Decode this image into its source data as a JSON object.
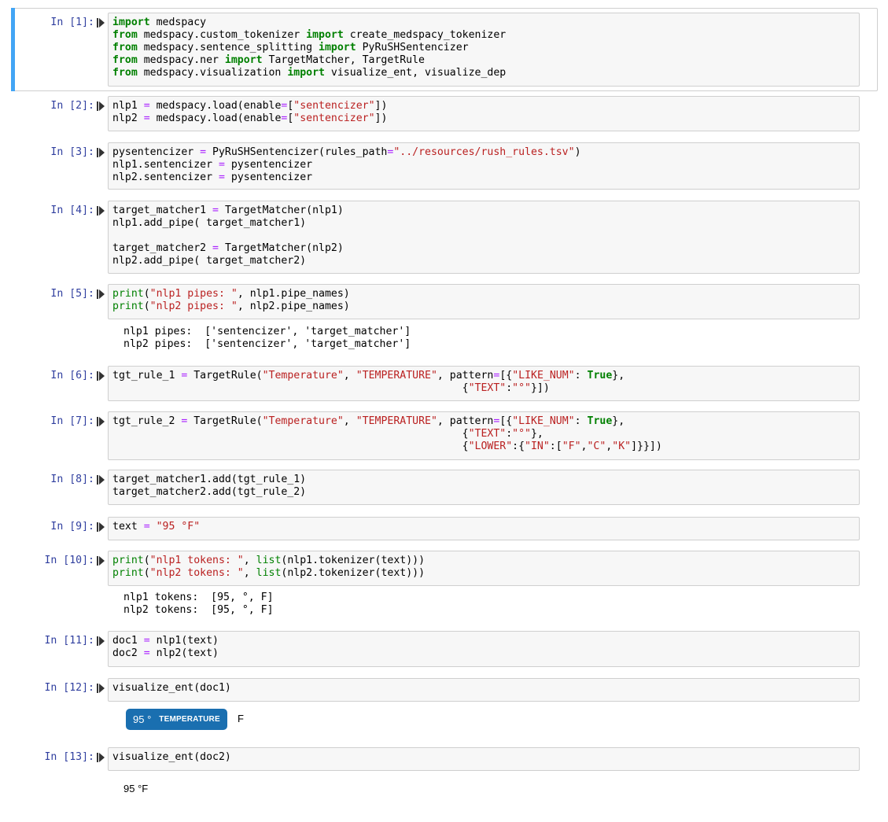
{
  "cells": [
    {
      "prompt": "In [1]:",
      "lines": [
        [
          [
            "kw",
            "import"
          ],
          [
            "t",
            " medspacy"
          ]
        ],
        [
          [
            "kw",
            "from"
          ],
          [
            "t",
            " medspacy.custom_tokenizer "
          ],
          [
            "kw",
            "import"
          ],
          [
            "t",
            " create_medspacy_tokenizer"
          ]
        ],
        [
          [
            "kw",
            "from"
          ],
          [
            "t",
            " medspacy.sentence_splitting "
          ],
          [
            "kw",
            "import"
          ],
          [
            "t",
            " PyRuSHSentencizer"
          ]
        ],
        [
          [
            "kw",
            "from"
          ],
          [
            "t",
            " medspacy.ner "
          ],
          [
            "kw",
            "import"
          ],
          [
            "t",
            " TargetMatcher, TargetRule"
          ]
        ],
        [
          [
            "kw",
            "from"
          ],
          [
            "t",
            " medspacy.visualization "
          ],
          [
            "kw",
            "import"
          ],
          [
            "t",
            " visualize_ent, visualize_dep"
          ]
        ]
      ]
    },
    {
      "prompt": "In [2]:",
      "lines": [
        [
          [
            "t",
            "nlp1 "
          ],
          [
            "op",
            "="
          ],
          [
            "t",
            " medspacy.load(enable"
          ],
          [
            "op",
            "="
          ],
          [
            "t",
            "["
          ],
          [
            "str",
            "\"sentencizer\""
          ],
          [
            "t",
            "])"
          ]
        ],
        [
          [
            "t",
            "nlp2 "
          ],
          [
            "op",
            "="
          ],
          [
            "t",
            " medspacy.load(enable"
          ],
          [
            "op",
            "="
          ],
          [
            "t",
            "["
          ],
          [
            "str",
            "\"sentencizer\""
          ],
          [
            "t",
            "])"
          ]
        ]
      ]
    },
    {
      "prompt": "In [3]:",
      "lines": [
        [
          [
            "t",
            "pysentencizer "
          ],
          [
            "op",
            "="
          ],
          [
            "t",
            " PyRuSHSentencizer(rules_path"
          ],
          [
            "op",
            "="
          ],
          [
            "str",
            "\"../resources/rush_rules.tsv\""
          ],
          [
            "t",
            ")"
          ]
        ],
        [
          [
            "t",
            "nlp1.sentencizer "
          ],
          [
            "op",
            "="
          ],
          [
            "t",
            " pysentencizer"
          ]
        ],
        [
          [
            "t",
            "nlp2.sentencizer "
          ],
          [
            "op",
            "="
          ],
          [
            "t",
            " pysentencizer"
          ]
        ]
      ]
    },
    {
      "prompt": "In [4]:",
      "lines": [
        [
          [
            "t",
            "target_matcher1 "
          ],
          [
            "op",
            "="
          ],
          [
            "t",
            " TargetMatcher(nlp1)"
          ]
        ],
        [
          [
            "t",
            "nlp1.add_pipe( target_matcher1)"
          ]
        ],
        [
          [
            "t",
            ""
          ]
        ],
        [
          [
            "t",
            "target_matcher2 "
          ],
          [
            "op",
            "="
          ],
          [
            "t",
            " TargetMatcher(nlp2)"
          ]
        ],
        [
          [
            "t",
            "nlp2.add_pipe( target_matcher2)"
          ]
        ]
      ]
    },
    {
      "prompt": "In [5]:",
      "lines": [
        [
          [
            "bi",
            "print"
          ],
          [
            "t",
            "("
          ],
          [
            "str",
            "\"nlp1 pipes: \""
          ],
          [
            "t",
            ", nlp1.pipe_names)"
          ]
        ],
        [
          [
            "bi",
            "print"
          ],
          [
            "t",
            "("
          ],
          [
            "str",
            "\"nlp2 pipes: \""
          ],
          [
            "t",
            ", nlp2.pipe_names)"
          ]
        ]
      ],
      "output": [
        "nlp1 pipes:  ['sentencizer', 'target_matcher']",
        "nlp2 pipes:  ['sentencizer', 'target_matcher']"
      ]
    },
    {
      "prompt": "In [6]:",
      "lines": [
        [
          [
            "t",
            "tgt_rule_1 "
          ],
          [
            "op",
            "="
          ],
          [
            "t",
            " TargetRule("
          ],
          [
            "str",
            "\"Temperature\""
          ],
          [
            "t",
            ", "
          ],
          [
            "str",
            "\"TEMPERATURE\""
          ],
          [
            "t",
            ", pattern"
          ],
          [
            "op",
            "="
          ],
          [
            "t",
            "[{"
          ],
          [
            "str",
            "\"LIKE_NUM\""
          ],
          [
            "t",
            ": "
          ],
          [
            "kw",
            "True"
          ],
          [
            "t",
            "},"
          ]
        ],
        [
          [
            "t",
            "                                                        {"
          ],
          [
            "str",
            "\"TEXT\""
          ],
          [
            "t",
            ":"
          ],
          [
            "str",
            "\"°\""
          ],
          [
            "t",
            "}])"
          ]
        ]
      ]
    },
    {
      "prompt": "In [7]:",
      "lines": [
        [
          [
            "t",
            "tgt_rule_2 "
          ],
          [
            "op",
            "="
          ],
          [
            "t",
            " TargetRule("
          ],
          [
            "str",
            "\"Temperature\""
          ],
          [
            "t",
            ", "
          ],
          [
            "str",
            "\"TEMPERATURE\""
          ],
          [
            "t",
            ", pattern"
          ],
          [
            "op",
            "="
          ],
          [
            "t",
            "[{"
          ],
          [
            "str",
            "\"LIKE_NUM\""
          ],
          [
            "t",
            ": "
          ],
          [
            "kw",
            "True"
          ],
          [
            "t",
            "},"
          ]
        ],
        [
          [
            "t",
            "                                                        {"
          ],
          [
            "str",
            "\"TEXT\""
          ],
          [
            "t",
            ":"
          ],
          [
            "str",
            "\"°\""
          ],
          [
            "t",
            "},"
          ]
        ],
        [
          [
            "t",
            "                                                        {"
          ],
          [
            "str",
            "\"LOWER\""
          ],
          [
            "t",
            ":{"
          ],
          [
            "str",
            "\"IN\""
          ],
          [
            "t",
            ":["
          ],
          [
            "str",
            "\"F\""
          ],
          [
            "t",
            ","
          ],
          [
            "str",
            "\"C\""
          ],
          [
            "t",
            ","
          ],
          [
            "str",
            "\"K\""
          ],
          [
            "t",
            "]}}])"
          ]
        ]
      ]
    },
    {
      "prompt": "In [8]:",
      "lines": [
        [
          [
            "t",
            "target_matcher1.add(tgt_rule_1)"
          ]
        ],
        [
          [
            "t",
            "target_matcher2.add(tgt_rule_2)"
          ]
        ]
      ]
    },
    {
      "prompt": "In [9]:",
      "lines": [
        [
          [
            "t",
            "text "
          ],
          [
            "op",
            "="
          ],
          [
            "t",
            " "
          ],
          [
            "str",
            "\"95 °F\""
          ]
        ]
      ]
    },
    {
      "prompt": "In [10]:",
      "lines": [
        [
          [
            "bi",
            "print"
          ],
          [
            "t",
            "("
          ],
          [
            "str",
            "\"nlp1 tokens: \""
          ],
          [
            "t",
            ", "
          ],
          [
            "bi",
            "list"
          ],
          [
            "t",
            "(nlp1.tokenizer(text)))"
          ]
        ],
        [
          [
            "bi",
            "print"
          ],
          [
            "t",
            "("
          ],
          [
            "str",
            "\"nlp2 tokens: \""
          ],
          [
            "t",
            ", "
          ],
          [
            "bi",
            "list"
          ],
          [
            "t",
            "(nlp2.tokenizer(text)))"
          ]
        ]
      ],
      "output": [
        "nlp1 tokens:  [95, °, F]",
        "nlp2 tokens:  [95, °, F]"
      ]
    },
    {
      "prompt": "In [11]:",
      "lines": [
        [
          [
            "t",
            "doc1 "
          ],
          [
            "op",
            "="
          ],
          [
            "t",
            " nlp1(text)"
          ]
        ],
        [
          [
            "t",
            "doc2 "
          ],
          [
            "op",
            "="
          ],
          [
            "t",
            " nlp2(text)"
          ]
        ]
      ]
    },
    {
      "prompt": "In [12]:",
      "lines": [
        [
          [
            "t",
            "visualize_ent(doc1)"
          ]
        ]
      ]
    },
    {
      "prompt": "In [13]:",
      "lines": [
        [
          [
            "t",
            "visualize_ent(doc2)"
          ]
        ]
      ]
    }
  ],
  "entity_output": {
    "entity_text": "95 °",
    "entity_label": "TEMPERATURE",
    "trailing_text": "F",
    "color": "#1a6fb0"
  },
  "plain_output": "95 °F"
}
